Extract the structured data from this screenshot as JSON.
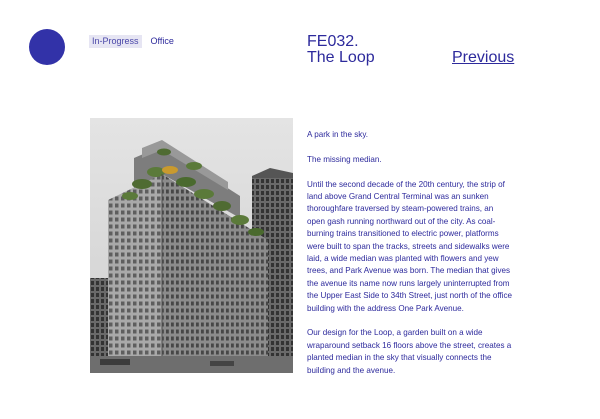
{
  "tags": {
    "status": "In-Progress",
    "type": "Office"
  },
  "project": {
    "code": "FE032.",
    "name": "The Loop"
  },
  "nav": {
    "previous_label": "Previous"
  },
  "colors": {
    "accent": "#3232a8",
    "text": "#2d2a9c",
    "tag_bg": "#e6e5f3"
  },
  "paragraphs": [
    "A park in the sky.",
    "The missing median.",
    "Until the second decade of the 20th century, the strip of land above Grand Central Terminal was an sunken thoroughfare traversed by steam-powered trains, an open gash running northward out of the city. As coal-burning trains transitioned to electric power, platforms were built to span the tracks, streets and sidewalks were laid, a wide median was planted with flowers and yew trees, and Park Avenue was born. The median that gives the avenue its name now runs largely uninterrupted from the Upper East Side to 34th Street, just north of the office building with the address One Park Avenue.",
    "Our design for the Loop, a garden built on a wide wraparound setback 16 floors above the street, creates a planted median in the sky that visually connects the building and the avenue."
  ]
}
